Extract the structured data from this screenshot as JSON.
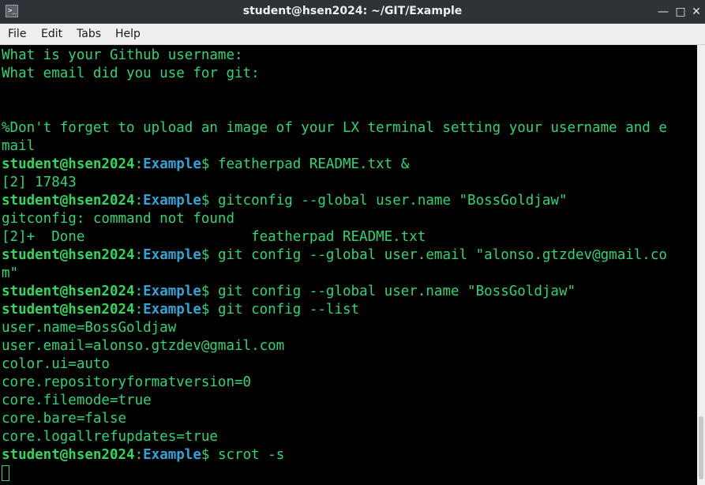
{
  "window": {
    "title": "student@hsen2024: ~/GIT/Example",
    "icon_name": "terminal-icon",
    "controls": {
      "minimize": "—",
      "maximize": "□",
      "close": "✕"
    }
  },
  "menu": {
    "items": [
      "File",
      "Edit",
      "Tabs",
      "Help"
    ]
  },
  "prompt": {
    "user": "student@hsen2024",
    "sep": ":",
    "dir": "Example",
    "sym": "$ "
  },
  "colors": {
    "text": "#2ed573",
    "prompt_user": "#30d65d",
    "prompt_dir": "#31a4d6",
    "background": "#000000"
  },
  "terminal": {
    "plain": {
      "0": "What is your Github username:",
      "1": "What email did you use for git:",
      "4": "%Don't forget to upload an image of your LX terminal setting your username and e",
      "5": "mail",
      "7": "[2] 17843",
      "9": "gitconfig: command not found",
      "10": "[2]+  Done                    featherpad README.txt",
      "12": "m\"",
      "15": "user.name=BossGoldjaw",
      "16": "user.email=alonso.gtzdev@gmail.com",
      "17": "color.ui=auto",
      "18": "core.repositoryformatversion=0",
      "19": "core.filemode=true",
      "20": "core.bare=false",
      "21": "core.logallrefupdates=true"
    },
    "commands": {
      "6": "featherpad README.txt &",
      "8": "gitconfig --global user.name \"BossGoldjaw\"",
      "11": "git config --global user.email \"alonso.gtzdev@gmail.co",
      "13": "git config --global user.name \"BossGoldjaw\"",
      "14": "git config --list",
      "22": "scrot -s"
    }
  }
}
